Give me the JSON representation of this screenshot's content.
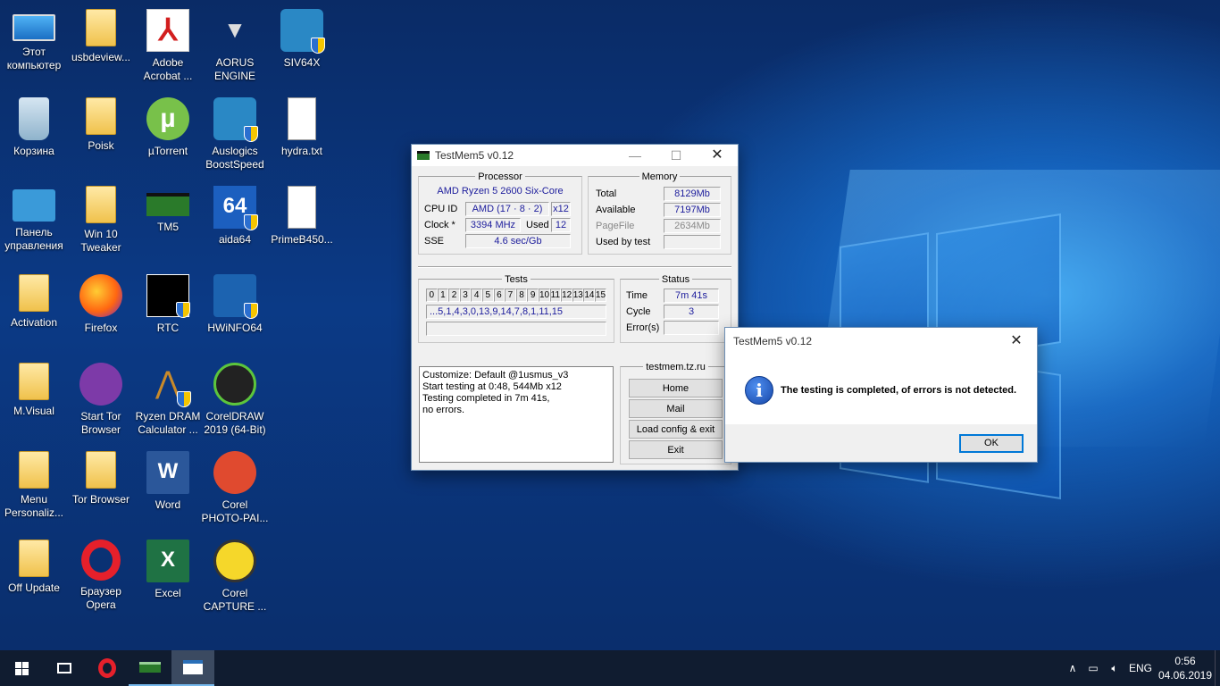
{
  "desktop": {
    "icons": [
      {
        "label": "Этот компьютер",
        "icon": "computer-icon"
      },
      {
        "label": "usbdeview...",
        "icon": "folder-icon"
      },
      {
        "label": "Adobe Acrobat ...",
        "icon": "adobe-acrobat-icon"
      },
      {
        "label": "AORUS ENGINE",
        "icon": "aorus-icon"
      },
      {
        "label": "SIV64X",
        "icon": "siv-wizard-icon"
      },
      {
        "label": "Корзина",
        "icon": "recycle-bin-icon"
      },
      {
        "label": "Poisk",
        "icon": "folder-icon"
      },
      {
        "label": "µTorrent",
        "icon": "utorrent-icon"
      },
      {
        "label": "Auslogics BoostSpeed",
        "icon": "boostspeed-icon"
      },
      {
        "label": "hydra.txt",
        "icon": "text-file-icon"
      },
      {
        "label": "Панель управления",
        "icon": "control-panel-icon"
      },
      {
        "label": "Win 10 Tweaker",
        "icon": "folder-icon"
      },
      {
        "label": "TM5",
        "icon": "ram-icon"
      },
      {
        "label": "aida64",
        "icon": "aida64-icon"
      },
      {
        "label": "PrimeB450...",
        "icon": "text-file-icon"
      },
      {
        "label": "Activation",
        "icon": "folder-icon"
      },
      {
        "label": "Firefox",
        "icon": "firefox-icon"
      },
      {
        "label": "RTC",
        "icon": "rtc-icon"
      },
      {
        "label": "HWiNFO64",
        "icon": "hwinfo-icon"
      },
      {
        "label": "M.Visual",
        "icon": "folder-icon"
      },
      {
        "label": "Start Tor Browser",
        "icon": "tor-icon"
      },
      {
        "label": "Ryzen DRAM Calculator ...",
        "icon": "dram-calculator-icon"
      },
      {
        "label": "CorelDRAW 2019 (64-Bit)",
        "icon": "coreldraw-icon"
      },
      {
        "label": "Menu Personaliz...",
        "icon": "folder-icon"
      },
      {
        "label": "Tor Browser",
        "icon": "folder-icon"
      },
      {
        "label": "Word",
        "icon": "word-icon"
      },
      {
        "label": "Corel PHOTO-PAI...",
        "icon": "corel-photopaint-icon"
      },
      {
        "label": "Off Update",
        "icon": "folder-icon"
      },
      {
        "label": "Браузер Opera",
        "icon": "opera-icon"
      },
      {
        "label": "Excel",
        "icon": "excel-icon"
      },
      {
        "label": "Corel CAPTURE ...",
        "icon": "corel-capture-icon"
      }
    ]
  },
  "tm5": {
    "title": "TestMem5 v0.12",
    "processor": {
      "group": "Processor",
      "name": "AMD Ryzen 5 2600 Six-Core",
      "cpuid_label": "CPU ID",
      "cpuid": "AMD  (17 · 8 · 2)",
      "cores": "x12",
      "clock_label": "Clock *",
      "clock": "3394 MHz",
      "used_label": "Used",
      "used": "12",
      "sse_label": "SSE",
      "sse": "4.6 sec/Gb"
    },
    "memory": {
      "group": "Memory",
      "total_label": "Total",
      "total": "8129Mb",
      "available_label": "Available",
      "available": "7197Mb",
      "pagefile_label": "PageFile",
      "pagefile": "2634Mb",
      "usedbytest_label": "Used by test",
      "usedbytest": ""
    },
    "tests": {
      "group": "Tests",
      "cells": [
        "0",
        "1",
        "2",
        "3",
        "4",
        "5",
        "6",
        "7",
        "8",
        "9",
        "10",
        "11",
        "12",
        "13",
        "14",
        "15"
      ],
      "sequence": "...5,1,4,3,0,13,9,14,7,8,1,11,15"
    },
    "status": {
      "group": "Status",
      "time_label": "Time",
      "time": "7m 41s",
      "cycle_label": "Cycle",
      "cycle": "3",
      "errors_label": "Error(s)",
      "errors": ""
    },
    "log": "Customize: Default @1usmus_v3\nStart testing at 0:48, 544Mb x12\nTesting completed in 7m 41s,\nno errors.",
    "site": {
      "group": "testmem.tz.ru",
      "home": "Home",
      "mail": "Mail",
      "load": "Load config & exit",
      "exit": "Exit"
    }
  },
  "dialog": {
    "title": "TestMem5 v0.12",
    "message": "The testing is completed, of errors is not detected.",
    "ok": "OK"
  },
  "taskbar": {
    "lang": "ENG",
    "time": "0:56",
    "date": "04.06.2019"
  }
}
